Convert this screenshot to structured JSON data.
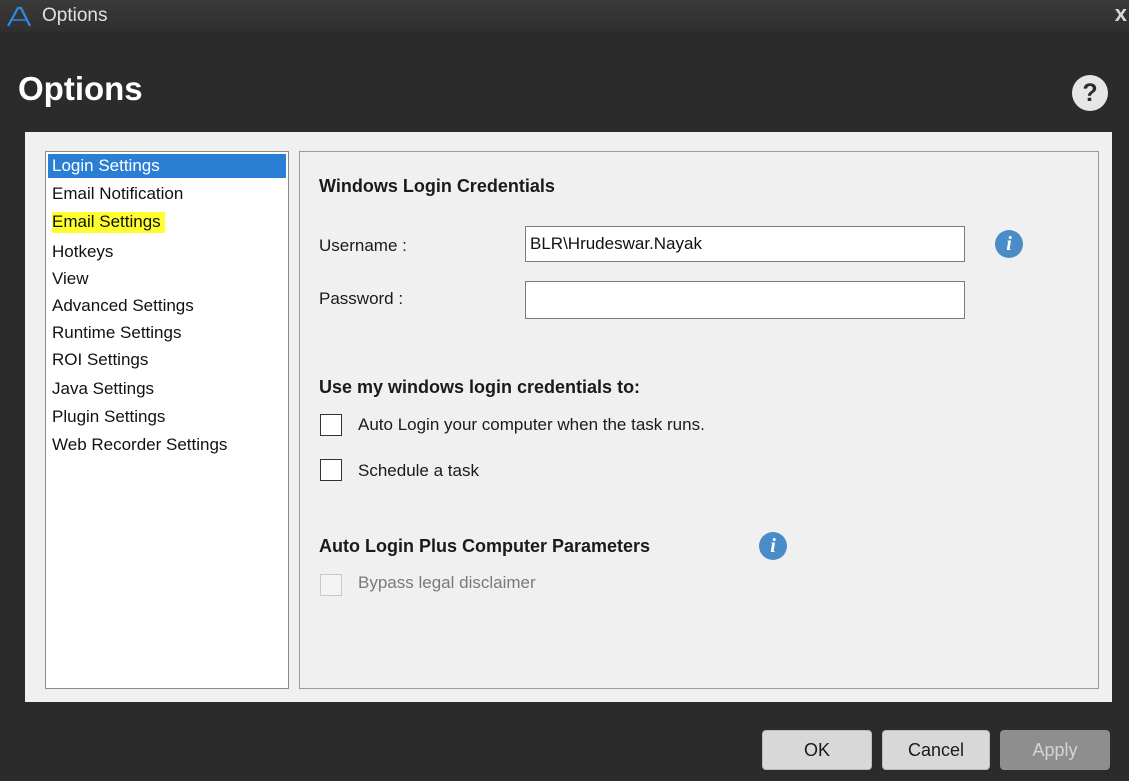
{
  "window": {
    "title": "Options",
    "close_glyph": "x"
  },
  "header": {
    "title": "Options",
    "help_glyph": "?"
  },
  "nav": {
    "items": [
      {
        "label": "Login Settings"
      },
      {
        "label": "Email Notification"
      },
      {
        "label": "Email Settings"
      },
      {
        "label": "Hotkeys"
      },
      {
        "label": "View"
      },
      {
        "label": "Advanced Settings"
      },
      {
        "label": "Runtime Settings"
      },
      {
        "label": "ROI Settings"
      },
      {
        "label": "Java Settings"
      },
      {
        "label": "Plugin Settings"
      },
      {
        "label": "Web Recorder Settings"
      }
    ]
  },
  "panel": {
    "credentials_title": "Windows Login Credentials",
    "username_label": "Username :",
    "username_value": "BLR\\Hrudeswar.Nayak",
    "password_label": "Password :",
    "password_value": "",
    "use_title": "Use my windows login credentials to:",
    "auto_login_label": "Auto Login your computer when the task runs.",
    "schedule_label": "Schedule a task",
    "params_title": "Auto Login Plus Computer Parameters",
    "bypass_label": "Bypass legal disclaimer",
    "info_glyph": "i"
  },
  "footer": {
    "ok_label": "OK",
    "cancel_label": "Cancel",
    "apply_label": "Apply"
  },
  "colors": {
    "window_bg": "#2b2b2b",
    "content_bg": "#f0f0f0",
    "selection": "#2a7fd4",
    "highlight": "#ffff30",
    "info_icon": "#4a8cc8"
  }
}
